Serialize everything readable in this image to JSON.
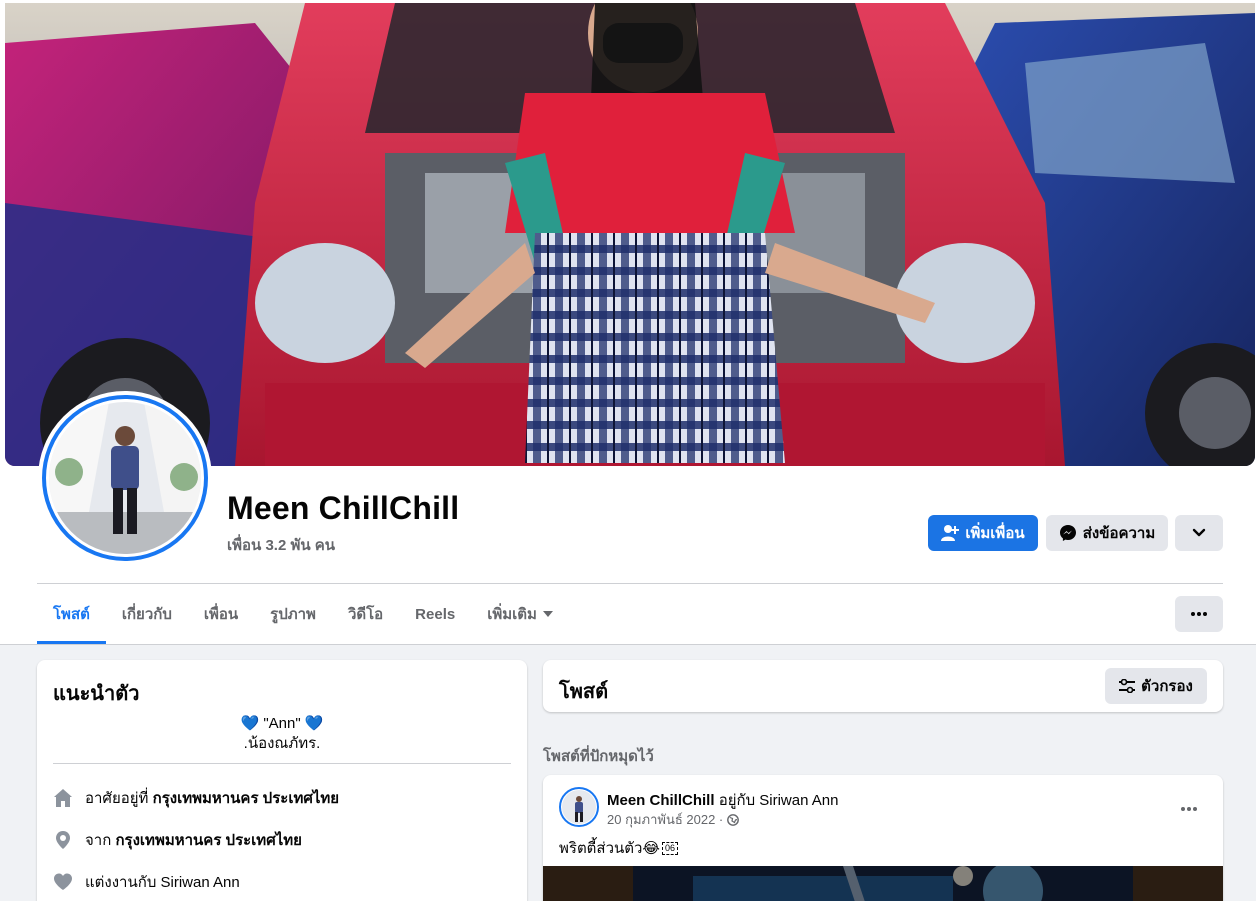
{
  "profile": {
    "name": "Meen ChillChill",
    "friends": "เพื่อน 3.2 พัน คน"
  },
  "actions": {
    "add_friend": "เพิ่มเพื่อน",
    "message": "ส่งข้อความ"
  },
  "tabs": [
    {
      "label": "โพสต์",
      "active": true
    },
    {
      "label": "เกี่ยวกับ"
    },
    {
      "label": "เพื่อน"
    },
    {
      "label": "รูปภาพ"
    },
    {
      "label": "วิดีโอ"
    },
    {
      "label": "Reels"
    },
    {
      "label": "เพิ่มเติม"
    }
  ],
  "intro": {
    "title": "แนะนำตัว",
    "bio_line1": "💙 \"Ann\" 💙",
    "bio_line2": ".น้องณภัทร.",
    "lives_prefix": "อาศัยอยู่ที่",
    "lives_value": "กรุงเทพมหานคร ประเทศไทย",
    "from_prefix": "จาก",
    "from_value": "กรุงเทพมหานคร ประเทศไทย",
    "relationship": "แต่งงานกับ Siriwan Ann"
  },
  "posts": {
    "title": "โพสต์",
    "filter": "ตัวกรอง",
    "pinned_label": "โพสต์ที่ปักหมุดไว้"
  },
  "post": {
    "author": "Meen ChillChill",
    "with_text": "อยู่กับ Siriwan Ann",
    "date": "20 กุมภาพันธ์ 2022 ·",
    "text": "พริตตี้ส่วนตัว😂",
    "badge": "06"
  },
  "colors": {
    "accent": "#1877f2",
    "background": "#f0f2f5",
    "secondary_text": "#65676b",
    "button_grey": "#e4e6eb"
  },
  "icons": {
    "add_friend": "person-plus-icon",
    "message": "messenger-icon",
    "more": "chevron-down-icon",
    "lives": "home-icon",
    "from": "location-pin-icon",
    "relationship": "heart-icon",
    "filter": "sliders-icon",
    "audience": "globe-icon"
  }
}
